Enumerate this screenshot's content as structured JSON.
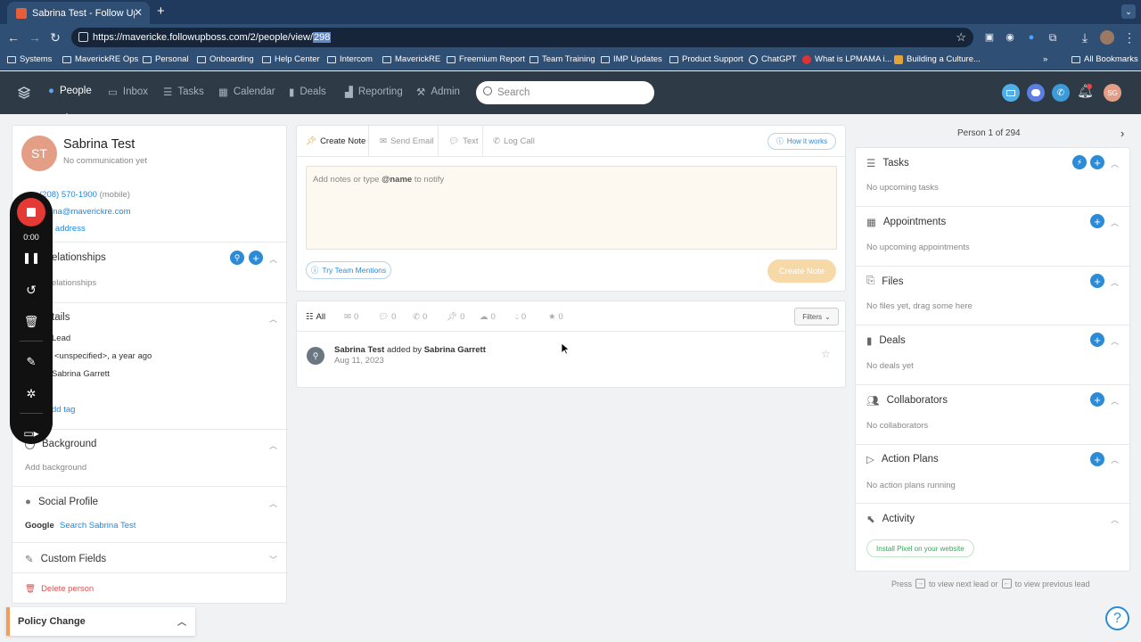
{
  "browser": {
    "tab_title": "Sabrina Test - Follow Up Boss",
    "url_main": "https://mavericke.followupboss.com/2/people/view/",
    "url_selected": "298",
    "bookmarks": [
      "Systems",
      "MaverickRE Ops",
      "Personal",
      "Onboarding",
      "Help Center",
      "Intercom",
      "MaverickRE",
      "Freemium Report",
      "Team Training",
      "IMP Updates",
      "Product Support",
      "ChatGPT",
      "What is LPMAMA i...",
      "Building a Culture...",
      "All Bookmarks"
    ],
    "more": "»"
  },
  "nav": {
    "items": [
      "People",
      "Inbox",
      "Tasks",
      "Calendar",
      "Deals",
      "Reporting",
      "Admin"
    ],
    "search_placeholder": "Search",
    "avatar_initials": "SG",
    "accent": "#2c8bd7"
  },
  "person": {
    "initials": "ST",
    "name": "Sabrina Test",
    "subtitle": "No communication yet",
    "phone": "(208) 570-1900",
    "phone_type": "(mobile)",
    "email": "rina@maverickre.com",
    "address_link": "d address",
    "relationships_title": "elationships",
    "relationships_empty": "elationships",
    "details_title": "tails",
    "stage": "Lead",
    "source": "<unspecified>, a year ago",
    "agent": "Sabrina Garrett",
    "tag_link": "dd tag",
    "background_title": "Background",
    "background_link": "Add background",
    "social_title": "Social Profile",
    "social_google": "Google",
    "social_search": "Search Sabrina Test",
    "custom_fields": "Custom Fields",
    "delete": "Delete person",
    "policy": "Policy Change"
  },
  "composer": {
    "tabs": [
      "Create Note",
      "Send Email",
      "Text",
      "Log Call"
    ],
    "how": "How it works",
    "placeholder_pre": "Add notes or type ",
    "placeholder_bold": "@name",
    "placeholder_post": " to notify",
    "mentions": "Try Team Mentions",
    "create_btn": "Create Note"
  },
  "feed": {
    "all": "All",
    "counts": [
      "0",
      "0",
      "0",
      "0",
      "0",
      "0",
      "0"
    ],
    "filters": "Filters",
    "entry_name": "Sabrina Test",
    "entry_mid": " added by ",
    "entry_by": "Sabrina Garrett",
    "entry_date": "Aug 11, 2023"
  },
  "right": {
    "pager": "Person 1 of 294",
    "sections": [
      {
        "title": "Tasks",
        "empty": "No upcoming tasks"
      },
      {
        "title": "Appointments",
        "empty": "No upcoming appointments"
      },
      {
        "title": "Files",
        "empty": "No files yet, drag some here"
      },
      {
        "title": "Deals",
        "empty": "No deals yet"
      },
      {
        "title": "Collaborators",
        "empty": "No collaborators"
      },
      {
        "title": "Action Plans",
        "empty": "No action plans running"
      },
      {
        "title": "Activity",
        "empty": "Install Pixel on your website"
      }
    ],
    "hint_a": "Press",
    "hint_b": "to view next lead or",
    "hint_c": "to view previous lead"
  },
  "recorder": {
    "time": "0:00"
  }
}
